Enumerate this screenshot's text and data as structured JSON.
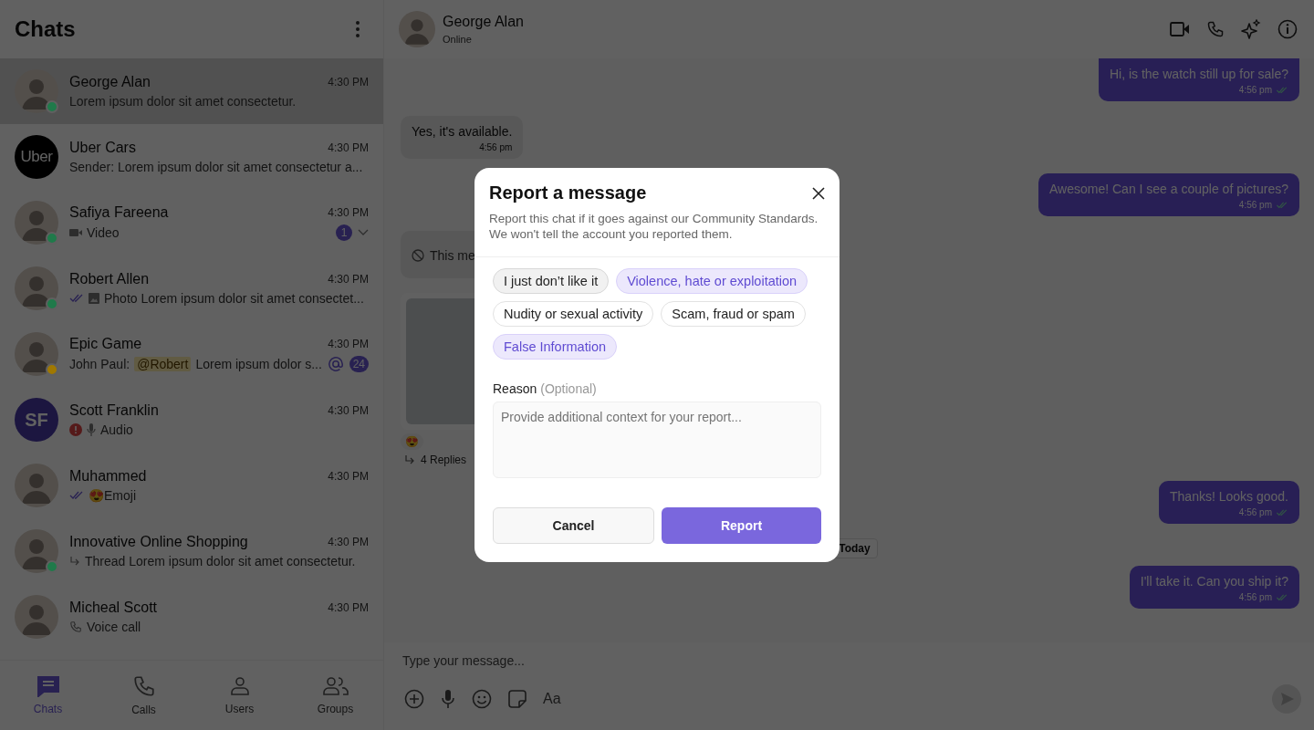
{
  "sidebar": {
    "title": "Chats",
    "chats": [
      {
        "name": "George Alan",
        "time": "4:30 PM",
        "kind": "photo",
        "color": "#1f7a4a",
        "selected": true,
        "preview": [
          {
            "kind": "text",
            "text": "Lorem ipsum dolor sit amet consectetur."
          }
        ]
      },
      {
        "name": "Uber Cars",
        "time": "4:30 PM",
        "kind": "logo",
        "avatar_text": "Uber",
        "selected": false,
        "preview": [
          {
            "kind": "text",
            "text": "Sender: Lorem ipsum dolor sit amet consectetur a..."
          }
        ]
      },
      {
        "name": "Safiya Fareena",
        "time": "4:30 PM",
        "kind": "photo",
        "color": "#1f7a4a",
        "selected": false,
        "unread": "1",
        "menu": true,
        "preview": [
          {
            "kind": "video"
          },
          {
            "kind": "text",
            "text": "Video"
          }
        ]
      },
      {
        "name": "Robert Allen",
        "time": "4:30 PM",
        "kind": "photo",
        "color": "#1f7a4a",
        "selected": false,
        "preview": [
          {
            "kind": "ticks"
          },
          {
            "kind": "photo"
          },
          {
            "kind": "text",
            "text": "Photo Lorem ipsum dolor sit amet consectet..."
          }
        ]
      },
      {
        "name": "Epic Game",
        "time": "4:30 PM",
        "kind": "photo",
        "color": "#a07800",
        "selected": false,
        "mention": true,
        "unread": "24",
        "preview": [
          {
            "kind": "text",
            "text": "John Paul:"
          },
          {
            "kind": "tag",
            "text": "@Robert"
          },
          {
            "kind": "text",
            "text": "Lorem ipsum dolor s..."
          }
        ]
      },
      {
        "name": "Scott Franklin",
        "time": "4:30 PM",
        "kind": "initials",
        "avatar_text": "SF",
        "selected": false,
        "preview": [
          {
            "kind": "error"
          },
          {
            "kind": "mic"
          },
          {
            "kind": "text",
            "text": "Audio"
          }
        ]
      },
      {
        "name": "Muhammed",
        "time": "4:30 PM",
        "kind": "photo",
        "selected": false,
        "preview": [
          {
            "kind": "ticks"
          },
          {
            "kind": "text",
            "text": "😍Emoji"
          }
        ]
      },
      {
        "name": "Innovative Online Shopping",
        "time": "4:30 PM",
        "kind": "photo",
        "color": "#1f7a4a",
        "selected": false,
        "preview": [
          {
            "kind": "thread"
          },
          {
            "kind": "text",
            "text": "Thread Lorem ipsum dolor sit amet consectetur."
          }
        ]
      },
      {
        "name": "Micheal Scott",
        "time": "4:30 PM",
        "kind": "photo",
        "selected": false,
        "preview": [
          {
            "kind": "call"
          },
          {
            "kind": "text",
            "text": "Voice call"
          }
        ]
      }
    ],
    "nav": [
      {
        "label": "Chats",
        "selected": true
      },
      {
        "label": "Calls",
        "selected": false
      },
      {
        "label": "Users",
        "selected": false
      },
      {
        "label": "Groups",
        "selected": false
      }
    ]
  },
  "header": {
    "name": "George Alan",
    "status": "Online"
  },
  "messages": [
    {
      "kind": "outgoing",
      "text": "Hi, is the watch still up for sale?",
      "time": "4:56 pm"
    },
    {
      "kind": "incoming",
      "text": "Yes, it's available.",
      "time": "4:56 pm"
    },
    {
      "kind": "outgoing",
      "text": "Awesome! Can I see a couple of pictures?",
      "time": "4:56 pm"
    },
    {
      "kind": "deleted",
      "text": "This me"
    },
    {
      "kind": "image",
      "reaction": "😍",
      "replies": "4 Replies"
    },
    {
      "kind": "outgoing",
      "text": "Thanks! Looks good.",
      "time": "4:56 pm"
    },
    {
      "kind": "date",
      "text": "Today"
    },
    {
      "kind": "outgoing",
      "text": "I'll take it. Can you ship it?",
      "time": "4:56 pm"
    }
  ],
  "composer": {
    "placeholder": "Type your message...",
    "tools": [
      {
        "kind": "plus"
      },
      {
        "kind": "mic"
      },
      {
        "kind": "emoji"
      },
      {
        "kind": "sticker"
      },
      {
        "kind": "text",
        "text": "Aa"
      }
    ]
  },
  "dialog": {
    "title": "Report a message",
    "description": "Report this chat if it goes against our Community Standards. We won't tell the account you reported them.",
    "options": [
      {
        "label": "I just don’t like it",
        "selected": false,
        "hovered": true
      },
      {
        "label": "Violence, hate or exploitation",
        "selected": true,
        "hovered": false
      },
      {
        "label": "Nudity or sexual activity",
        "selected": false,
        "hovered": false
      },
      {
        "label": "Scam, fraud or spam",
        "selected": false,
        "hovered": false
      },
      {
        "label": "False Information",
        "selected": true,
        "hovered": false
      }
    ],
    "reason_label": "Reason",
    "reason_hint": "(Optional)",
    "placeholder": "Provide additional context for your report...",
    "cancel": "Cancel",
    "submit": "Report"
  }
}
